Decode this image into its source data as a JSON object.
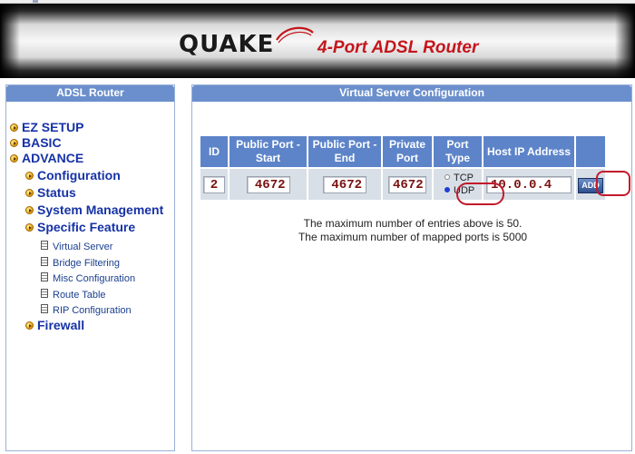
{
  "banner": {
    "brand": "QUAKE",
    "product": "4-Port ADSL Router"
  },
  "sidebar": {
    "title": "ADSL Router",
    "items": [
      {
        "label": "EZ SETUP"
      },
      {
        "label": "BASIC"
      },
      {
        "label": "ADVANCE"
      },
      {
        "label": "Configuration"
      },
      {
        "label": "Status"
      },
      {
        "label": "System Management"
      },
      {
        "label": "Specific Feature"
      },
      {
        "label": "Virtual Server"
      },
      {
        "label": "Bridge Filtering"
      },
      {
        "label": "Misc Configuration"
      },
      {
        "label": "Route Table"
      },
      {
        "label": "RIP Configuration"
      },
      {
        "label": "Firewall"
      }
    ]
  },
  "content": {
    "title": "Virtual Server Configuration",
    "table": {
      "headers": [
        "ID",
        "Public Port - Start",
        "Public Port - End",
        "Private Port",
        "Port Type",
        "Host IP Address"
      ],
      "row": {
        "id": "2",
        "public_start": "4672",
        "public_end": "4672",
        "private_port": "4672",
        "port_type_options": [
          "TCP",
          "UDP"
        ],
        "port_type_selected": "UDP",
        "host_ip": "10.0.0.4",
        "add_label": "ADD"
      }
    },
    "notes": [
      "The maximum number of entries above is 50.",
      "The maximum number of mapped ports is 5000"
    ]
  },
  "colors": {
    "accent_header": "#6b8fcc",
    "table_header": "#5d84c9",
    "nav_text": "#1632a6",
    "brand_red": "#c4161c",
    "highlight_ring": "#c21a2b"
  },
  "icons": {
    "nav_bullet": "arrow-bullet-icon",
    "page": "document-icon",
    "logo_swoosh": "swoosh-icon"
  }
}
